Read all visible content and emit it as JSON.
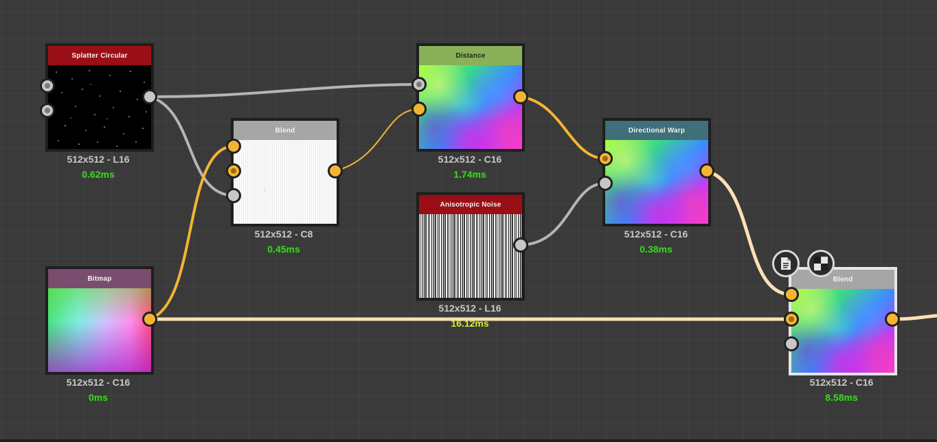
{
  "nodes": {
    "splatter": {
      "title": "Splatter Circular",
      "resolution": "512x512 - L16",
      "time": "0.62ms",
      "header_color": "#9a0f16"
    },
    "blend1": {
      "title": "Blend",
      "resolution": "512x512 - C8",
      "time": "0.45ms",
      "header_color": "#a6a6a6"
    },
    "distance": {
      "title": "Distance",
      "resolution": "512x512 - C16",
      "time": "1.74ms",
      "header_color": "#8ab05a"
    },
    "noise": {
      "title": "Anisotropic Noise",
      "resolution": "512x512 - L16",
      "time": "16.12ms",
      "header_color": "#9a0f16"
    },
    "warp": {
      "title": "Directional Warp",
      "resolution": "512x512 - C16",
      "time": "0.38ms",
      "header_color": "#3f6f78"
    },
    "bitmap": {
      "title": "Bitmap",
      "resolution": "512x512 - C16",
      "time": "0ms",
      "header_color": "#7a4c6e"
    },
    "blend2": {
      "title": "Blend",
      "resolution": "512x512 - C16",
      "time": "8.58ms",
      "header_color": "#a6a6a6"
    }
  },
  "toolbar": {
    "icons": [
      "document-icon",
      "checkerboard-icon"
    ]
  },
  "colors": {
    "wire_gray": "#b5b5b5",
    "wire_orange": "#f4b433",
    "wire_cream": "#fbe0b4",
    "time_green": "#33e015",
    "time_yellow": "#d9ef2a"
  }
}
